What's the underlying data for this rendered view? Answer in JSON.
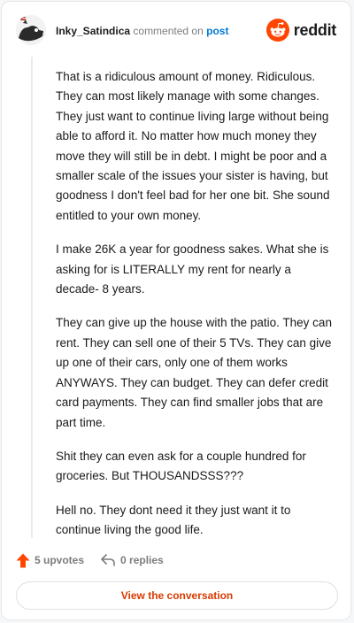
{
  "header": {
    "username": "Inky_Satindica",
    "verb": "commented on",
    "post_link": "post",
    "brand": "reddit"
  },
  "comment": {
    "paragraphs": [
      "That is a ridiculous amount of money. Ridiculous. They can most likely manage with some changes. They just want to continue living large without being able to afford it. No matter how much money they move they will still be in debt. I might be poor and a smaller scale of the issues your sister is having, but goodness I don't feel bad for her one bit. She sound entitled to your own money.",
      "I make 26K a year for goodness sakes. What she is asking for is LITERALLY my rent for nearly a decade- 8 years.",
      "They can give up the house with the patio. They can rent. They can sell one of their 5 TVs. They can give up one of their cars, only one of them works ANYWAYS. They can budget. They can defer credit card payments. They can find smaller jobs that are part time.",
      "Shit they can even ask for a couple hundred for groceries. But THOUSANDSSS???",
      "Hell no. They dont need it they just want it to continue living the good life."
    ]
  },
  "actions": {
    "upvotes": "5 upvotes",
    "replies": "0 replies"
  },
  "cta": {
    "label": "View the conversation"
  },
  "colors": {
    "brand_orange": "#ff4500",
    "link_blue": "#0079d3",
    "cta_text": "#d93a00"
  },
  "icons": [
    "avatar",
    "reddit-logo-icon",
    "upvote-arrow-icon",
    "reply-icon"
  ]
}
